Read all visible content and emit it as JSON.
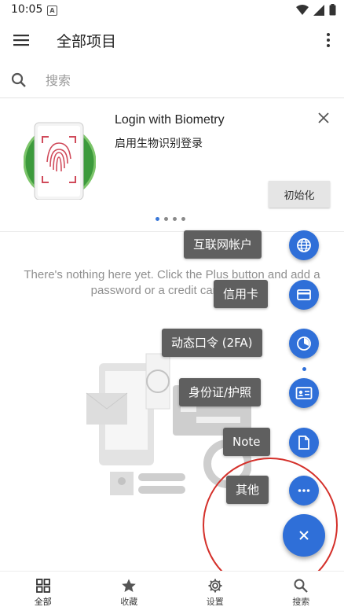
{
  "status": {
    "time": "10:05",
    "notif_letter": "A"
  },
  "appbar": {
    "title": "全部项目"
  },
  "search": {
    "placeholder": "搜索"
  },
  "promo": {
    "title": "Login with Biometry",
    "subtitle": "启用生物识别登录",
    "action": "初始化",
    "pages": 4,
    "active_page": 1
  },
  "empty": {
    "message": "There's nothing here yet. Click the Plus button and add a password or a credit card here."
  },
  "speed_dial": [
    {
      "label": "互联网帐户",
      "icon": "globe-icon"
    },
    {
      "label": "信用卡",
      "icon": "credit-card-icon"
    },
    {
      "label": "动态口令 (2FA)",
      "icon": "timer-icon"
    },
    {
      "label": "身份证/护照",
      "icon": "id-card-icon"
    },
    {
      "label": "Note",
      "icon": "document-icon"
    },
    {
      "label": "其他",
      "icon": "more-icon"
    }
  ],
  "bottom_nav": [
    {
      "label": "全部",
      "icon": "grid-icon",
      "active": true
    },
    {
      "label": "收藏",
      "icon": "star-icon",
      "active": false
    },
    {
      "label": "设置",
      "icon": "gear-icon",
      "active": false
    },
    {
      "label": "搜索",
      "icon": "search-icon",
      "active": false
    }
  ],
  "colors": {
    "accent": "#2f6fd8",
    "highlight_circle": "#d4302a",
    "label_bg": "#5f5f5f"
  }
}
